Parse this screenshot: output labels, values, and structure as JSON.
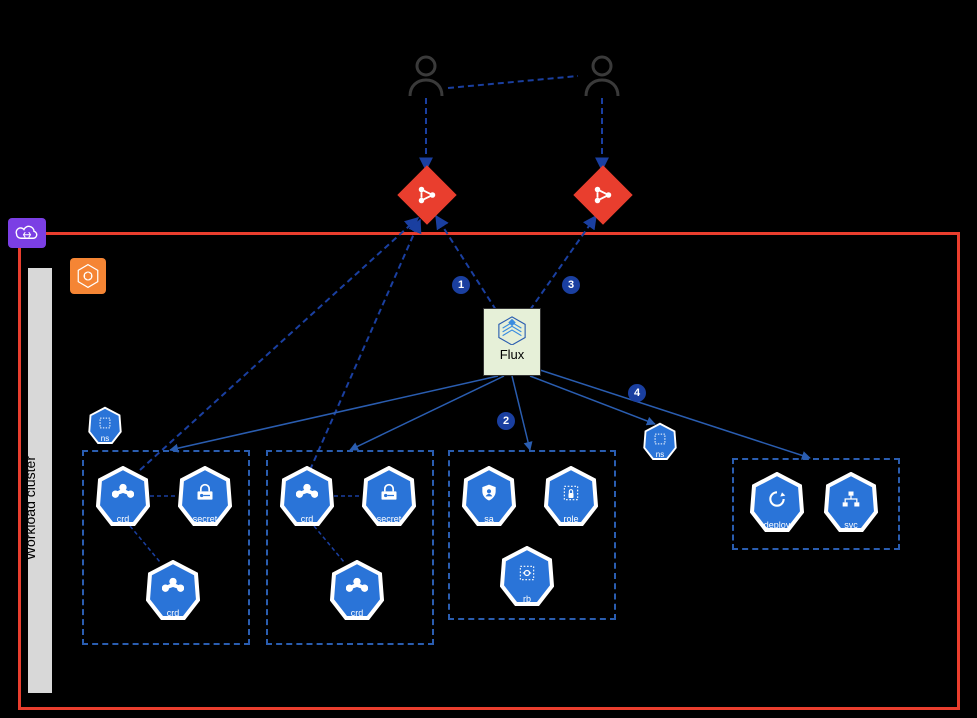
{
  "diagram": {
    "workload_label": "Workload cluster",
    "flux_label": "Flux",
    "steps": {
      "s1": "1",
      "s2": "2",
      "s3": "3",
      "s4": "4"
    },
    "hex_labels": {
      "ns": "ns",
      "crd": "crd",
      "secret": "secret",
      "sa": "sa",
      "role": "role",
      "rb": "rb",
      "deploy": "deploy",
      "svc": "svc"
    }
  }
}
